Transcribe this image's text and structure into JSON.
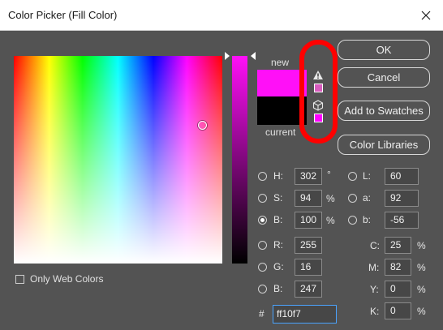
{
  "window": {
    "title": "Color Picker (Fill Color)",
    "close_icon": "close-icon"
  },
  "preview": {
    "new_label": "new",
    "current_label": "current",
    "new_color": "#ff10f7",
    "current_color": "#000000",
    "gamut_warning_icon": "warning-icon",
    "gamut_swatch_color": "#d85cbe",
    "web_safe_icon": "cube-icon",
    "web_safe_swatch_color": "#ff00ff"
  },
  "buttons": {
    "ok": "OK",
    "cancel": "Cancel",
    "add_to_swatches": "Add to Swatches",
    "color_libraries": "Color Libraries"
  },
  "hsb": {
    "h": {
      "label": "H:",
      "value": "302",
      "unit": "°"
    },
    "s": {
      "label": "S:",
      "value": "94",
      "unit": "%"
    },
    "b": {
      "label": "B:",
      "value": "100",
      "unit": "%"
    }
  },
  "lab": {
    "l": {
      "label": "L:",
      "value": "60"
    },
    "a": {
      "label": "a:",
      "value": "92"
    },
    "b": {
      "label": "b:",
      "value": "-56"
    }
  },
  "rgb": {
    "r": {
      "label": "R:",
      "value": "255"
    },
    "g": {
      "label": "G:",
      "value": "16"
    },
    "b": {
      "label": "B:",
      "value": "247"
    }
  },
  "cmyk": {
    "c": {
      "label": "C:",
      "value": "25",
      "unit": "%"
    },
    "m": {
      "label": "M:",
      "value": "82",
      "unit": "%"
    },
    "y": {
      "label": "Y:",
      "value": "0",
      "unit": "%"
    },
    "k": {
      "label": "K:",
      "value": "0",
      "unit": "%"
    }
  },
  "hex": {
    "label": "#",
    "value": "ff10f7"
  },
  "only_web_colors": {
    "label": "Only Web Colors",
    "checked": false
  },
  "selected_mode": "B",
  "annotation_color": "#ff0000"
}
